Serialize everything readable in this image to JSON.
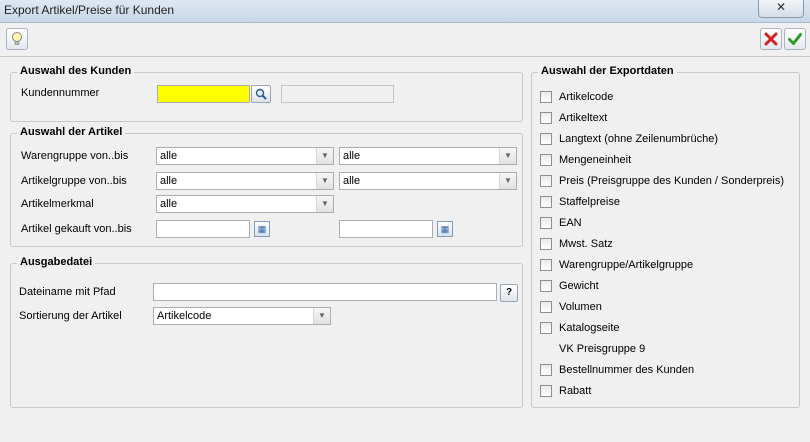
{
  "window": {
    "title": "Export Artikel/Preise für Kunden",
    "close_symbol": "✕"
  },
  "toolbar": {
    "help_icon": "lightbulb-icon",
    "cancel_icon": "red-x-icon",
    "ok_icon": "green-check-icon"
  },
  "kunde": {
    "legend": "Auswahl des Kunden",
    "kundennummer_label": "Kundennummer",
    "kundennummer_value": "",
    "kunden_name_value": "",
    "highlight_color": "#ffff00"
  },
  "artikel": {
    "legend": "Auswahl der Artikel",
    "warengruppe_label": "Warengruppe von..bis",
    "warengruppe_von": "alle",
    "warengruppe_bis": "alle",
    "artikelgruppe_label": "Artikelgruppe von..bis",
    "artikelgruppe_von": "alle",
    "artikelgruppe_bis": "alle",
    "artikelmerkmal_label": "Artikelmerkmal",
    "artikelmerkmal_value": "alle",
    "gekauft_label": "Artikel gekauft von..bis",
    "gekauft_von": "",
    "gekauft_bis": ""
  },
  "ausgabe": {
    "legend": "Ausgabedatei",
    "dateiname_label": "Dateiname mit Pfad",
    "dateiname_value": "",
    "help_label": "?",
    "sortierung_label": "Sortierung der Artikel",
    "sortierung_value": "Artikelcode"
  },
  "export": {
    "legend": "Auswahl der Exportdaten",
    "items": [
      {
        "label": "Artikelcode",
        "checked": false,
        "checkbox": true
      },
      {
        "label": "Artikeltext",
        "checked": false,
        "checkbox": true
      },
      {
        "label": "Langtext (ohne Zeilenumbrüche)",
        "checked": false,
        "checkbox": true
      },
      {
        "label": "Mengeneinheit",
        "checked": false,
        "checkbox": true
      },
      {
        "label": "Preis (Preisgruppe des Kunden / Sonderpreis)",
        "checked": false,
        "checkbox": true
      },
      {
        "label": "Staffelpreise",
        "checked": false,
        "checkbox": true
      },
      {
        "label": "EAN",
        "checked": false,
        "checkbox": true
      },
      {
        "label": "Mwst. Satz",
        "checked": false,
        "checkbox": true
      },
      {
        "label": "Warengruppe/Artikelgruppe",
        "checked": false,
        "checkbox": true
      },
      {
        "label": "Gewicht",
        "checked": false,
        "checkbox": true
      },
      {
        "label": "Volumen",
        "checked": false,
        "checkbox": true
      },
      {
        "label": "Katalogseite",
        "checked": false,
        "checkbox": true
      },
      {
        "label": "VK Preisgruppe 9",
        "checked": false,
        "checkbox": false
      },
      {
        "label": "Bestellnummer des Kunden",
        "checked": false,
        "checkbox": true
      },
      {
        "label": "Rabatt",
        "checked": false,
        "checkbox": true
      }
    ]
  }
}
